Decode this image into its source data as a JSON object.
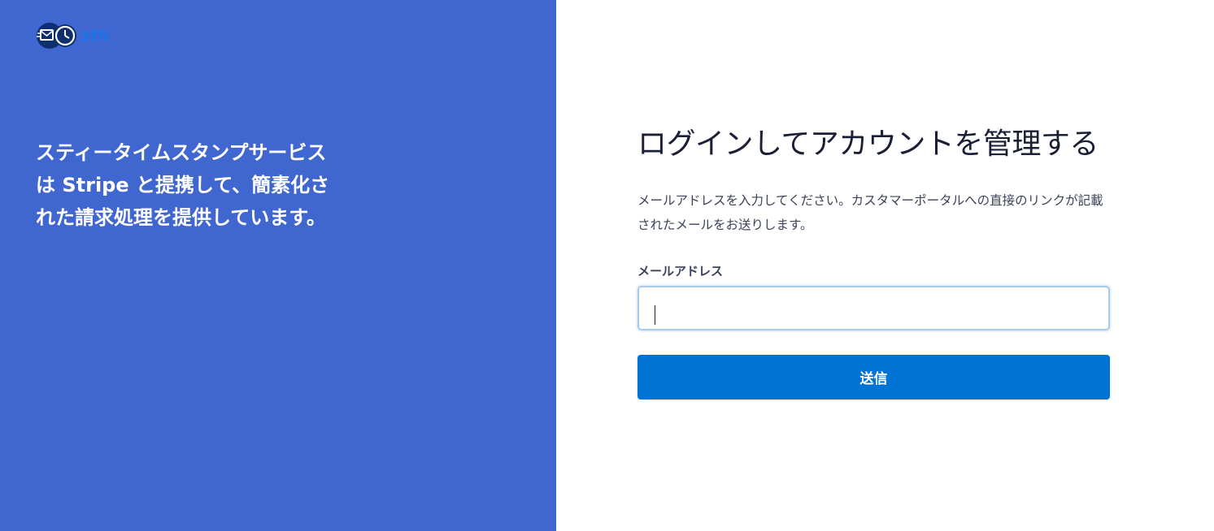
{
  "brand": {
    "logo_icon": "envelope-clock-logo",
    "logo_text": "sth",
    "tagline": "スティータイムスタンプサービスは Stripe と提携して、簡素化された請求処理を提供しています。"
  },
  "login": {
    "title": "ログインしてアカウントを管理する",
    "description": "メールアドレスを入力してください。カスタマーポータルへの直接のリンクが記載されたメールをお送りします。",
    "email_label": "メールアドレス",
    "email_value": "",
    "submit_label": "送信"
  },
  "colors": {
    "left_panel_bg": "#4067cf",
    "button_bg": "#0074d4",
    "title_text": "#1a1f36",
    "body_text": "#3c4257"
  }
}
